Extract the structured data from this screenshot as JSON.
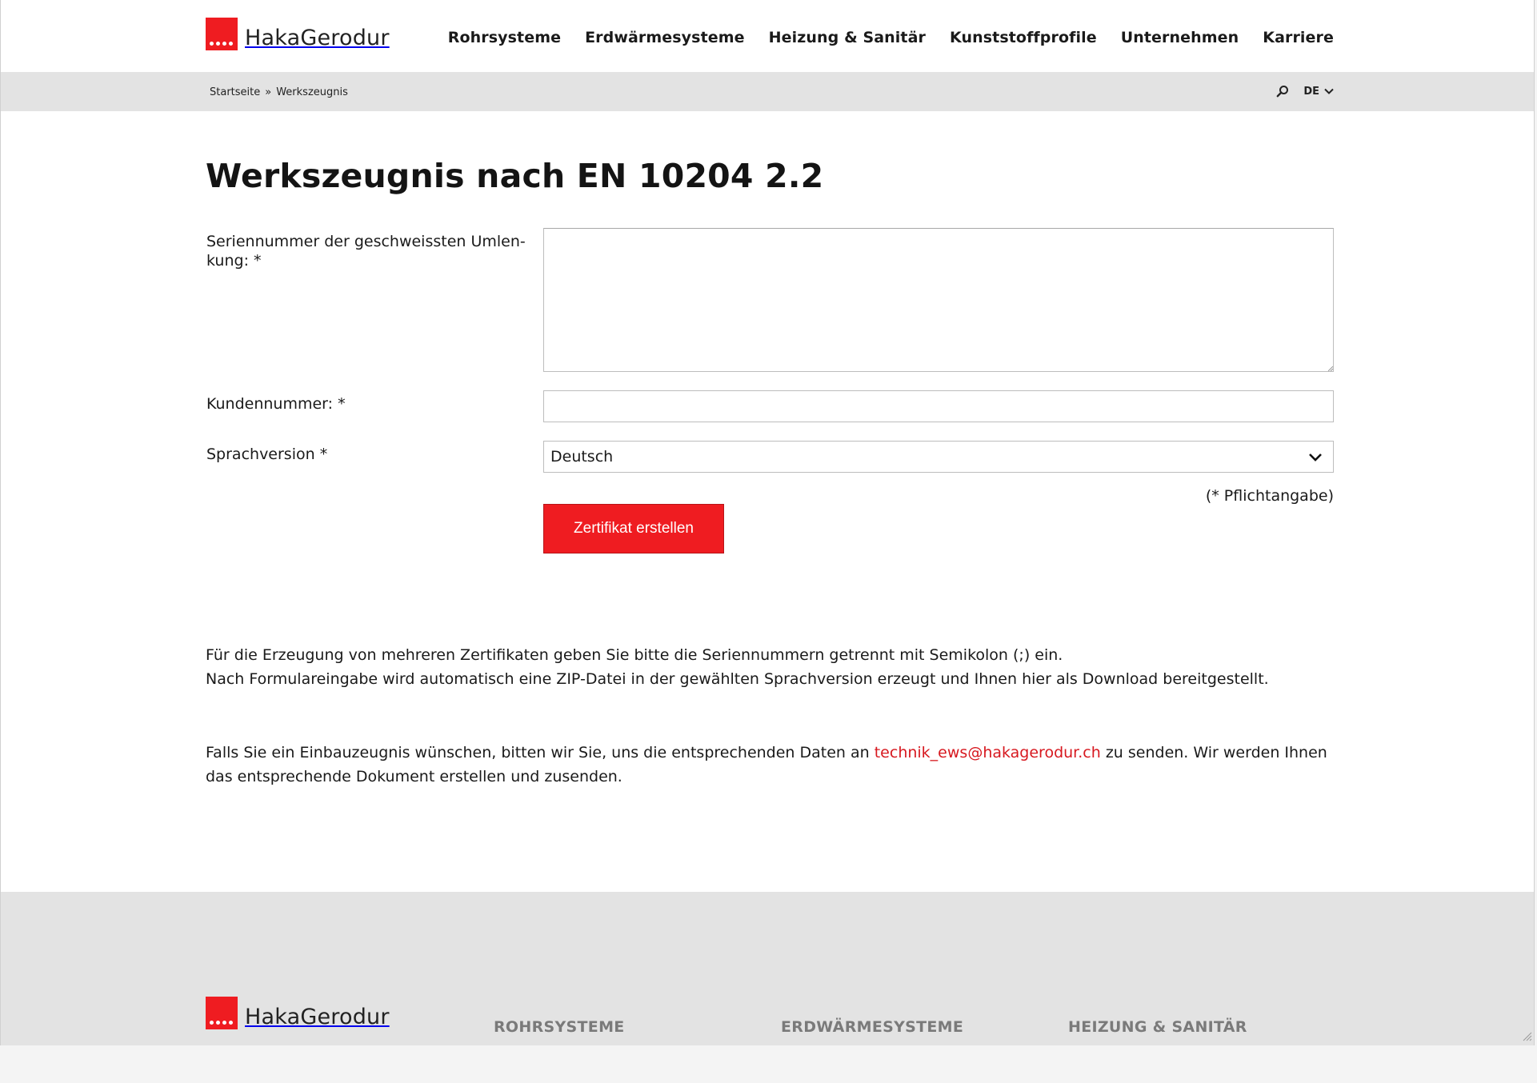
{
  "header": {
    "brand": "HakaGerodur",
    "nav": [
      "Rohrsysteme",
      "Erdwärmesysteme",
      "Heizung & Sanitär",
      "Kunststoffprofile",
      "Unternehmen",
      "Karriere"
    ]
  },
  "breadcrumb": {
    "home": "Startseite",
    "separator": "»",
    "current": "Werkszeugnis"
  },
  "tools": {
    "language": "DE"
  },
  "page": {
    "title": "Werkszeugnis nach EN 10204 2.2"
  },
  "form": {
    "serial_label_line1": "Seriennummer der geschweissten Umlen-",
    "serial_label_line2": "kung: *",
    "serial_value": "",
    "customer_label": "Kundennummer: *",
    "customer_value": "",
    "language_label": "Sprachversion *",
    "language_selected": "Deutsch",
    "required_note": "(* Pflichtangabe)",
    "submit_label": "Zertifikat erstellen"
  },
  "info": {
    "line1": "Für die Erzeugung von mehreren Zertifikaten geben Sie bitte die Seriennummern getrennt mit Semikolon (;) ein.",
    "line2": "Nach Formulareingabe wird automatisch eine ZIP-Datei in der gewählten Sprachversion erzeugt und Ihnen hier als Download bereitgestellt.",
    "contact_before": "Falls Sie ein Einbauzeugnis wünschen, bitten wir Sie, uns die entsprechenden Daten an ",
    "contact_email": "technik_ews@hakagerodur.ch",
    "contact_after": " zu senden. Wir werden Ihnen das entsprechende Dokument erstellen und zusenden."
  },
  "footer": {
    "brand": "HakaGerodur",
    "columns": [
      "ROHRSYSTEME",
      "ERDWÄRMESYSTEME",
      "HEIZUNG & SANITÄR"
    ]
  },
  "colors": {
    "brand_red": "#ef1c21",
    "link_red": "#d7181f",
    "bar_gray": "#e3e3e3"
  }
}
